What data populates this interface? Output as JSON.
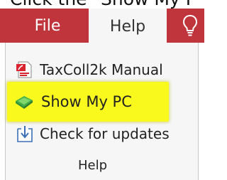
{
  "instruction": {
    "text": "Click the \"Show My P"
  },
  "ribbon": {
    "tabs": [
      {
        "label": "File"
      },
      {
        "label": "Help"
      }
    ],
    "tell_me_icon": "lightbulb-icon"
  },
  "help_group": {
    "commands": [
      {
        "label": "TaxColl2k Manual",
        "icon": "pdf-document-icon"
      },
      {
        "label": "Show My PC",
        "icon": "monitor-icon",
        "highlighted": true
      },
      {
        "label": "Check for updates",
        "icon": "download-arrow-icon"
      }
    ],
    "group_label": "Help"
  },
  "colors": {
    "ribbon_bg": "#c0353c",
    "panel_bg": "#f6f6f6",
    "highlight": "#f9f91d"
  }
}
